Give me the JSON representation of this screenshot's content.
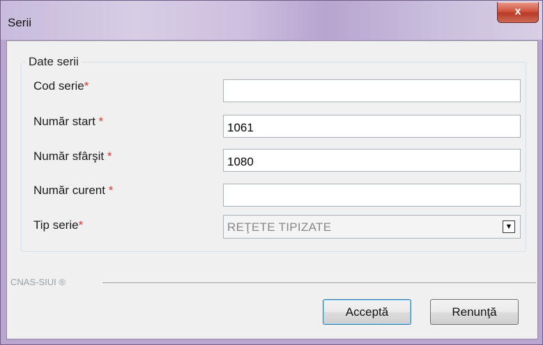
{
  "window": {
    "title": "Serii",
    "close_glyph": "x"
  },
  "group": {
    "legend": "Date serii"
  },
  "fields": [
    {
      "label": "Cod serie",
      "required": "*",
      "value": ""
    },
    {
      "label": "Număr start",
      "required": "*",
      "value": "1061"
    },
    {
      "label": "Număr sfârşit",
      "required": "*",
      "value": "1080"
    },
    {
      "label": "Număr curent",
      "required": "*",
      "value": ""
    }
  ],
  "tip_serie": {
    "label": "Tip serie",
    "required": "*",
    "selected": "REŢETE TIPIZATE",
    "icon": "chevron-down-icon"
  },
  "footer": {
    "brand": "CNAS-SIUI ®"
  },
  "buttons": {
    "accept": "Acceptă",
    "cancel": "Renunţă"
  },
  "colors": {
    "required_star": "#e0322c",
    "title_bar": "#c8bbdc",
    "close_button": "#c94a36"
  }
}
